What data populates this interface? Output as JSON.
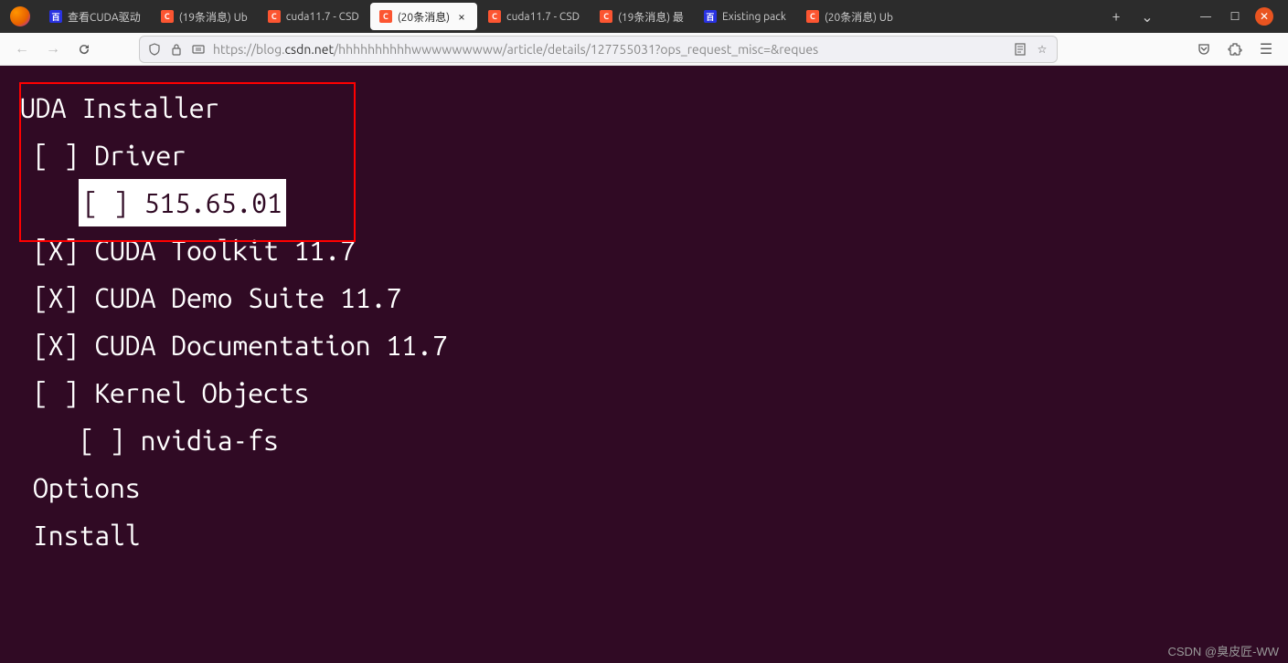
{
  "window": {
    "tabs": [
      {
        "favicon": "baidu",
        "label": "查看CUDA驱动"
      },
      {
        "favicon": "csdn",
        "label": "(19条消息) Ub"
      },
      {
        "favicon": "csdn",
        "label": "cuda11.7 - CSD"
      },
      {
        "favicon": "csdn",
        "label": "(20条消息)",
        "active": true
      },
      {
        "favicon": "csdn",
        "label": "cuda11.7 - CSD"
      },
      {
        "favicon": "csdn",
        "label": "(19条消息) 最"
      },
      {
        "favicon": "baidu",
        "label": "Existing pack"
      },
      {
        "favicon": "csdn",
        "label": "(20条消息) Ub"
      }
    ],
    "controls": {
      "minimize": "—",
      "maximize": "☐",
      "close": "✕"
    }
  },
  "url": {
    "scheme_icon": "🛡",
    "lock_icon": "🔒",
    "prefix": "https://blog.",
    "domain": "csdn.net",
    "path": "/hhhhhhhhhhwwwwwwwww/article/details/127755031?ops_request_misc=&reques",
    "reader_icon": "☰",
    "star_icon": "☆"
  },
  "toolbar": {
    "back": "←",
    "forward": "→",
    "reload": "↻",
    "pocket": "⌄",
    "extensions": "🧩",
    "menu": "☰"
  },
  "terminal": {
    "title": "UDA Installer",
    "items": [
      {
        "indent": 0,
        "check": " ",
        "label": "Driver"
      },
      {
        "indent": 1,
        "check": " ",
        "label": "515.65.01",
        "highlight": true
      },
      {
        "indent": 0,
        "check": "X",
        "label": "CUDA Toolkit 11.7"
      },
      {
        "indent": 0,
        "check": "X",
        "label": "CUDA Demo Suite 11.7"
      },
      {
        "indent": 0,
        "check": "X",
        "label": "CUDA Documentation 11.7"
      },
      {
        "indent": 0,
        "check": " ",
        "label": "Kernel Objects"
      },
      {
        "indent": 1,
        "check": " ",
        "label": "nvidia-fs"
      }
    ],
    "options": "Options",
    "install": "Install"
  },
  "watermark": "CSDN @臭皮匠-WW"
}
